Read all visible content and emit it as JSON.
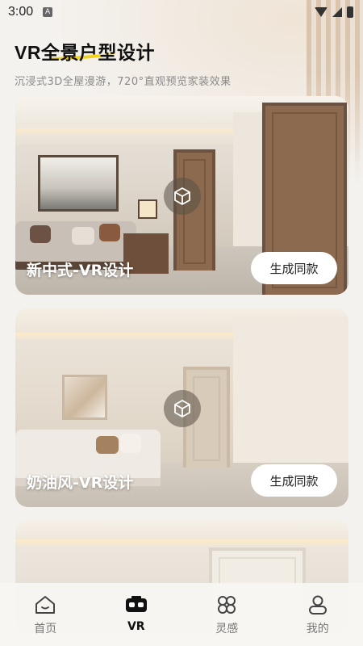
{
  "status_bar": {
    "time": "3:00",
    "notif_letter": "A"
  },
  "header": {
    "title": "VR全景户型设计",
    "subtitle": "沉浸式3D全屋漫游，720°直观预览家装效果"
  },
  "cards": [
    {
      "label": "新中式-VR设计",
      "button": "生成同款"
    },
    {
      "label": "奶油风-VR设计",
      "button": "生成同款"
    }
  ],
  "nav": [
    {
      "label": "首页",
      "icon": "home-icon",
      "active": false
    },
    {
      "label": "VR",
      "icon": "vr-headset-icon",
      "active": true
    },
    {
      "label": "灵感",
      "icon": "inspiration-icon",
      "active": false
    },
    {
      "label": "我的",
      "icon": "profile-icon",
      "active": false
    }
  ],
  "colors": {
    "accent_underline": "#f4d21c",
    "background": "#f4f2ef"
  }
}
